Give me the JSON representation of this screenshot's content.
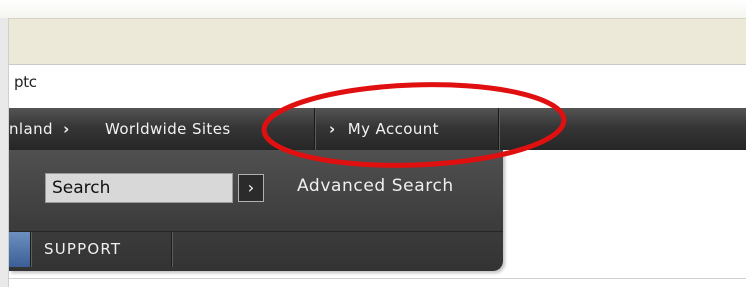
{
  "window": {
    "tab_title": "ptc"
  },
  "nav": {
    "items": [
      {
        "label": "nland"
      },
      {
        "label": "Worldwide Sites"
      },
      {
        "label": "My Account"
      }
    ],
    "chevron": "›"
  },
  "search": {
    "value": "Search",
    "go_label": "›",
    "advanced_label": "Advanced Search"
  },
  "tabs": {
    "support_label": "SUPPORT"
  },
  "annotation": {
    "color": "#e01010",
    "shape": "ellipse"
  }
}
